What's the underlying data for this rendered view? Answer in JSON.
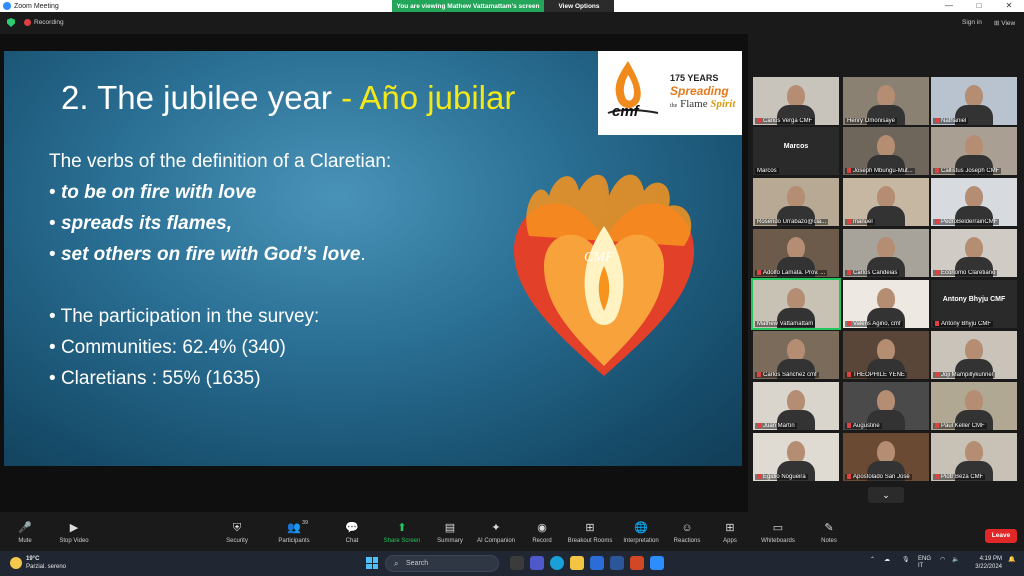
{
  "window": {
    "title": "Zoom Meeting",
    "controls": [
      "—",
      "□",
      "✕"
    ]
  },
  "banner": {
    "message": "You are viewing Mathew Vattamattam's screen",
    "options": "View Options"
  },
  "topbar": {
    "recording_label": "Recording",
    "signin_label": "Sign in",
    "view_label": "View"
  },
  "slide": {
    "title_main": "2. The jubilee year",
    "title_accent": " - Año jubilar",
    "logo": {
      "years": "175 YEARS",
      "line1": "Spreading",
      "line2a": "the",
      "line2b": "Flame",
      "line2c": "Spirit",
      "badge": "cmf"
    },
    "heart_label": "CMF",
    "lines": [
      "The verbs of the definition of a Claretian:",
      "to be on fire with love",
      "spreads its flames,",
      "set others on fire with God’s love",
      ".",
      "The participation in the survey:",
      "Communities: 62.4% (340)",
      "Claretians :  55% (1635)"
    ],
    "bullet": "•"
  },
  "participants": [
    {
      "name": "Carlos Verga CMF",
      "bg": "#c9c4bb",
      "muted": true
    },
    {
      "name": "Henry Omonisaye",
      "bg": "#8a8172",
      "muted": false
    },
    {
      "name": "Nathaniel",
      "bg": "#b8c3cf",
      "muted": true
    },
    {
      "name": "Marcos",
      "bg": "",
      "muted": false,
      "noimg": true
    },
    {
      "name": "Joseph Mbungu-Mut...",
      "bg": "#6e655b",
      "muted": true
    },
    {
      "name": "Callistus Joseph CMF",
      "bg": "#a99f92",
      "muted": true
    },
    {
      "name": "Rosendo Urrabazo@cla...",
      "bg": "#b7a994",
      "muted": false
    },
    {
      "name": "manuel",
      "bg": "#c6b7a2",
      "muted": true
    },
    {
      "name": "PedroBelderrainCMF",
      "bg": "#d7dbe0",
      "muted": true
    },
    {
      "name": "Adolfo Lamata. Prov. ...",
      "bg": "#6c5a4a",
      "muted": true
    },
    {
      "name": "Carlos Candeias",
      "bg": "#a7a29a",
      "muted": true
    },
    {
      "name": "Ecónomo Claretiano",
      "bg": "#d0cbc4",
      "muted": true
    },
    {
      "name": "Mathew Vattamattam",
      "bg": "#c8c2b5",
      "muted": false,
      "active": true
    },
    {
      "name": "Valens Agino, cmf",
      "bg": "#ede9e2",
      "muted": true
    },
    {
      "name": "Antony Bhyju CMF",
      "bg": "",
      "muted": true,
      "noimg": true
    },
    {
      "name": "Carlos Sánchez cmf",
      "bg": "#7b6b5b",
      "muted": true
    },
    {
      "name": "THEOPHILE YENE",
      "bg": "#5a4638",
      "muted": true
    },
    {
      "name": "Joji Mampillykunnel",
      "bg": "#c9c3ba",
      "muted": true
    },
    {
      "name": "Juan Martín",
      "bg": "#d9d4cc",
      "muted": true
    },
    {
      "name": "Augustine",
      "bg": "#4a4a4a",
      "muted": true
    },
    {
      "name": "Paul Keller  CMF",
      "bg": "#b1a894",
      "muted": true
    },
    {
      "name": "Egidio Nogueira",
      "bg": "#e0dbd2",
      "muted": true
    },
    {
      "name": "Apostolado San José",
      "bg": "#6b4a33",
      "muted": true
    },
    {
      "name": "Piotr Beza CMF",
      "bg": "#c8c1b6",
      "muted": true
    }
  ],
  "toolbar": {
    "items": [
      {
        "label": "Mute",
        "icon": "🎤"
      },
      {
        "label": "Stop Video",
        "icon": "▶"
      },
      {
        "label": "Security",
        "icon": "⛨"
      },
      {
        "label": "Participants",
        "icon": "👥",
        "count": "39"
      },
      {
        "label": "Chat",
        "icon": "💬"
      },
      {
        "label": "Share Screen",
        "icon": "⬆"
      },
      {
        "label": "Summary",
        "icon": "▤"
      },
      {
        "label": "AI Companion",
        "icon": "✦"
      },
      {
        "label": "Record",
        "icon": "◉"
      },
      {
        "label": "Breakout Rooms",
        "icon": "⊞"
      },
      {
        "label": "Interpretation",
        "icon": "🌐"
      },
      {
        "label": "Reactions",
        "icon": "☺"
      },
      {
        "label": "Apps",
        "icon": "⊞"
      },
      {
        "label": "Whiteboards",
        "icon": "▭"
      },
      {
        "label": "Notes",
        "icon": "✎"
      }
    ],
    "leave": "Leave"
  },
  "taskbar": {
    "weather_temp": "19°C",
    "weather_desc": "Parzial. sereno",
    "search_label": "Search",
    "lang": "ENG",
    "region": "IT",
    "time": "4:19 PM",
    "date": "3/22/2024"
  }
}
